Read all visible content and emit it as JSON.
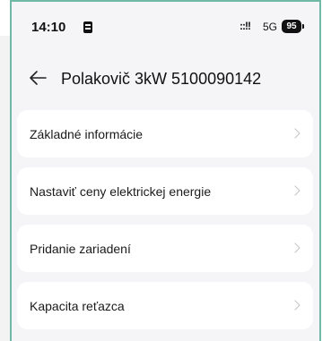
{
  "status_bar": {
    "time": "14:10",
    "signal": "::!!",
    "network": "5G",
    "battery": "95"
  },
  "header": {
    "title": "Polakovič 3kW 5100090142"
  },
  "menu": {
    "items": [
      {
        "label": "Základné informácie"
      },
      {
        "label": "Nastaviť ceny elektrickej energie"
      },
      {
        "label": "Pridanie zariadení"
      },
      {
        "label": "Kapacita reťazca"
      }
    ]
  },
  "icons": {
    "back": "arrow-left-icon",
    "chevron": "chevron-right-icon",
    "sim": "sim-card-icon"
  },
  "colors": {
    "frame_accent": "#6fb9a6",
    "background": "#f5f5f7",
    "card": "#ffffff"
  }
}
